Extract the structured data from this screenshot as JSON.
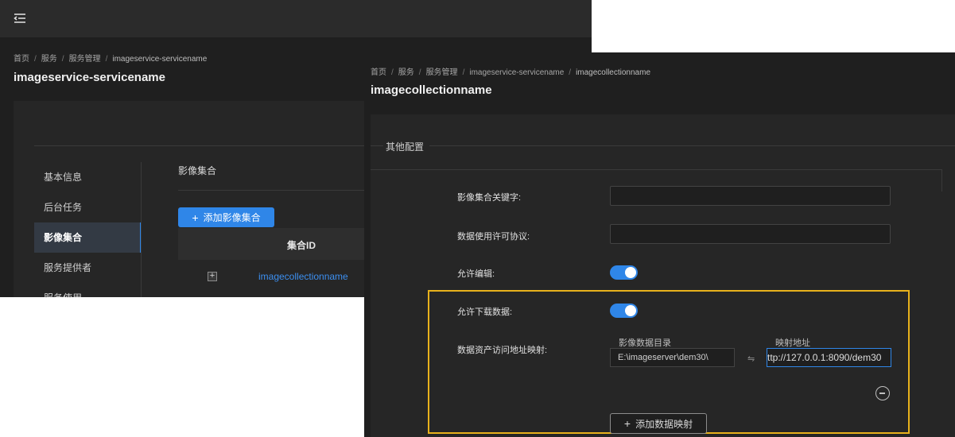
{
  "back": {
    "breadcrumb": {
      "items": [
        "首页",
        "服务",
        "服务管理",
        "imageservice-servicename"
      ],
      "separator": "/"
    },
    "title": "imageservice-servicename",
    "side_nav": {
      "items": [
        {
          "label": "基本信息",
          "active": false
        },
        {
          "label": "后台任务",
          "active": false
        },
        {
          "label": "影像集合",
          "active": true
        },
        {
          "label": "服务提供者",
          "active": false
        },
        {
          "label": "服务使用",
          "active": false
        }
      ]
    },
    "section_title": "影像集合",
    "add_button_label": "添加影像集合",
    "table": {
      "columns": [
        "集合ID"
      ],
      "rows": [
        {
          "id": "imagecollectionname"
        }
      ]
    }
  },
  "front": {
    "breadcrumb": {
      "items": [
        "首页",
        "服务",
        "服务管理",
        "imageservice-servicename",
        "imagecollectionname"
      ],
      "separator": "/"
    },
    "title": "imagecollectionname",
    "legend": "其他配置",
    "fields": {
      "keyword_label": "影像集合关键字:",
      "keyword_value": "",
      "license_label": "数据使用许可协议:",
      "license_value": "",
      "allow_edit_label": "允许编辑:",
      "allow_edit": true,
      "allow_download_label": "允许下载数据:",
      "allow_download": true,
      "mapping_label": "数据资产访问地址映射:"
    },
    "mapping": {
      "dir_header": "影像数据目录",
      "url_header": "映射地址",
      "rows": [
        {
          "dir": "E:\\imageserver\\dem30\\",
          "url": "ttp://127.0.0.1:8090/dem30"
        }
      ],
      "add_label": "添加数据映射"
    }
  },
  "colors": {
    "primary": "#2f86e8",
    "highlight": "#e8b21c",
    "background": "#1f1f1f"
  }
}
